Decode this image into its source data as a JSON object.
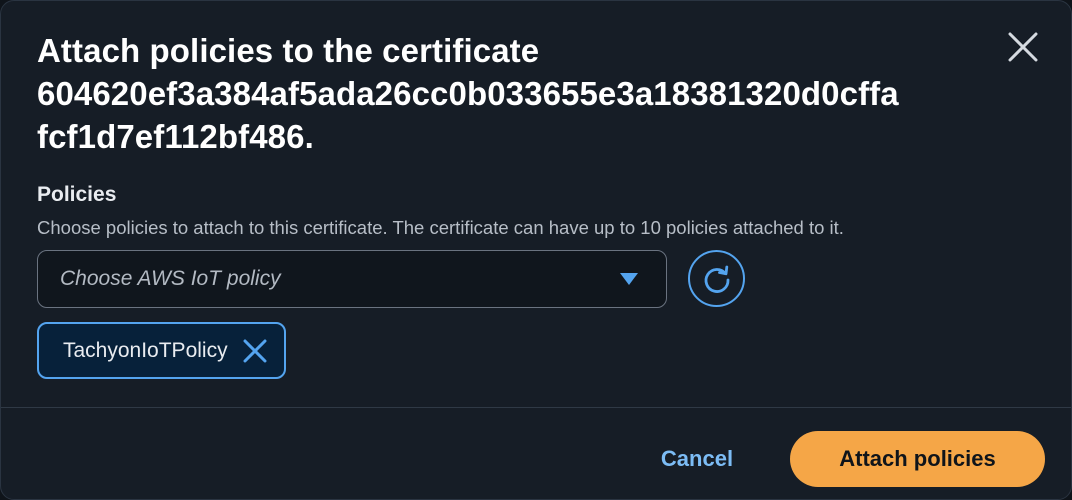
{
  "dialog": {
    "title_lines": [
      "Attach policies to the certificate",
      "604620ef3a384af5ada26cc0b033655e3a18381320d0cffa",
      "fcf1d7ef112bf486."
    ],
    "close_icon": "close-icon"
  },
  "policies_field": {
    "label": "Policies",
    "description": "Choose policies to attach to this certificate. The certificate can have up to 10 policies attached to it.",
    "select_placeholder": "Choose AWS IoT policy",
    "caret_icon": "caret-down-icon",
    "refresh_icon": "refresh-icon",
    "selected_tokens": [
      {
        "label": "TachyonIoTPolicy",
        "remove_icon": "close-icon"
      }
    ]
  },
  "footer": {
    "cancel_label": "Cancel",
    "primary_label": "Attach policies"
  },
  "colors": {
    "background": "#161d26",
    "accent_blue": "#54a4ef",
    "link_blue": "#7cbcf5",
    "primary_orange": "#f5a647",
    "token_bg": "#07213a"
  }
}
